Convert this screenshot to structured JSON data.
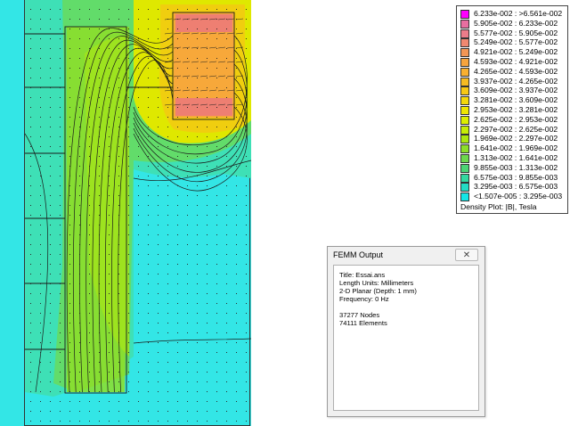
{
  "legend": {
    "entries": [
      {
        "label": "6.233e-002 : >6.561e-002",
        "color": "#ff00ff"
      },
      {
        "label": "5.905e-002 : 6.233e-002",
        "color": "#e86ea0"
      },
      {
        "label": "5.577e-002 : 5.905e-002",
        "color": "#ec7c8a"
      },
      {
        "label": "5.249e-002 : 5.577e-002",
        "color": "#f08870"
      },
      {
        "label": "4.921e-002 : 5.249e-002",
        "color": "#f29655"
      },
      {
        "label": "4.593e-002 : 4.921e-002",
        "color": "#f6a43e"
      },
      {
        "label": "4.265e-002 : 4.593e-002",
        "color": "#f8b030"
      },
      {
        "label": "3.937e-002 : 4.265e-002",
        "color": "#f6bb22"
      },
      {
        "label": "3.609e-002 : 3.937e-002",
        "color": "#f7c814"
      },
      {
        "label": "3.281e-002 : 3.609e-002",
        "color": "#f4d80a"
      },
      {
        "label": "2.953e-002 : 3.281e-002",
        "color": "#eee600"
      },
      {
        "label": "2.625e-002 : 2.953e-002",
        "color": "#dcee00"
      },
      {
        "label": "2.297e-002 : 2.625e-002",
        "color": "#c6ec06"
      },
      {
        "label": "1.969e-002 : 2.297e-002",
        "color": "#abe60e"
      },
      {
        "label": "1.641e-002 : 1.969e-002",
        "color": "#8cde28"
      },
      {
        "label": "1.313e-002 : 1.641e-002",
        "color": "#6cd84c"
      },
      {
        "label": "9.855e-003 : 1.313e-002",
        "color": "#4cd474"
      },
      {
        "label": "6.575e-003 : 9.855e-003",
        "color": "#34d8a0"
      },
      {
        "label": "3.295e-003 : 6.575e-003",
        "color": "#24dcc4"
      },
      {
        "label": "<1.507e-005 : 3.295e-003",
        "color": "#14e6e6"
      }
    ],
    "caption": "Density Plot: |B|, Tesla"
  },
  "output_window": {
    "title": "FEMM Output",
    "close_glyph": "✕",
    "lines": [
      "Title: Essai.ans",
      "Length Units: Millimeters",
      "2-D Planar (Depth: 1 mm)",
      "Frequency: 0 Hz",
      "",
      "37277 Nodes",
      "74111 Elements"
    ]
  },
  "colors": {
    "cyan": "#33e6e6",
    "teal": "#3ee0b6",
    "green": "#62dc6a",
    "lime": "#a2e41a",
    "yellow": "#dfe800",
    "orange": "#f7a83a",
    "hot": "#ee7f72",
    "line": "#1a1a1a"
  }
}
